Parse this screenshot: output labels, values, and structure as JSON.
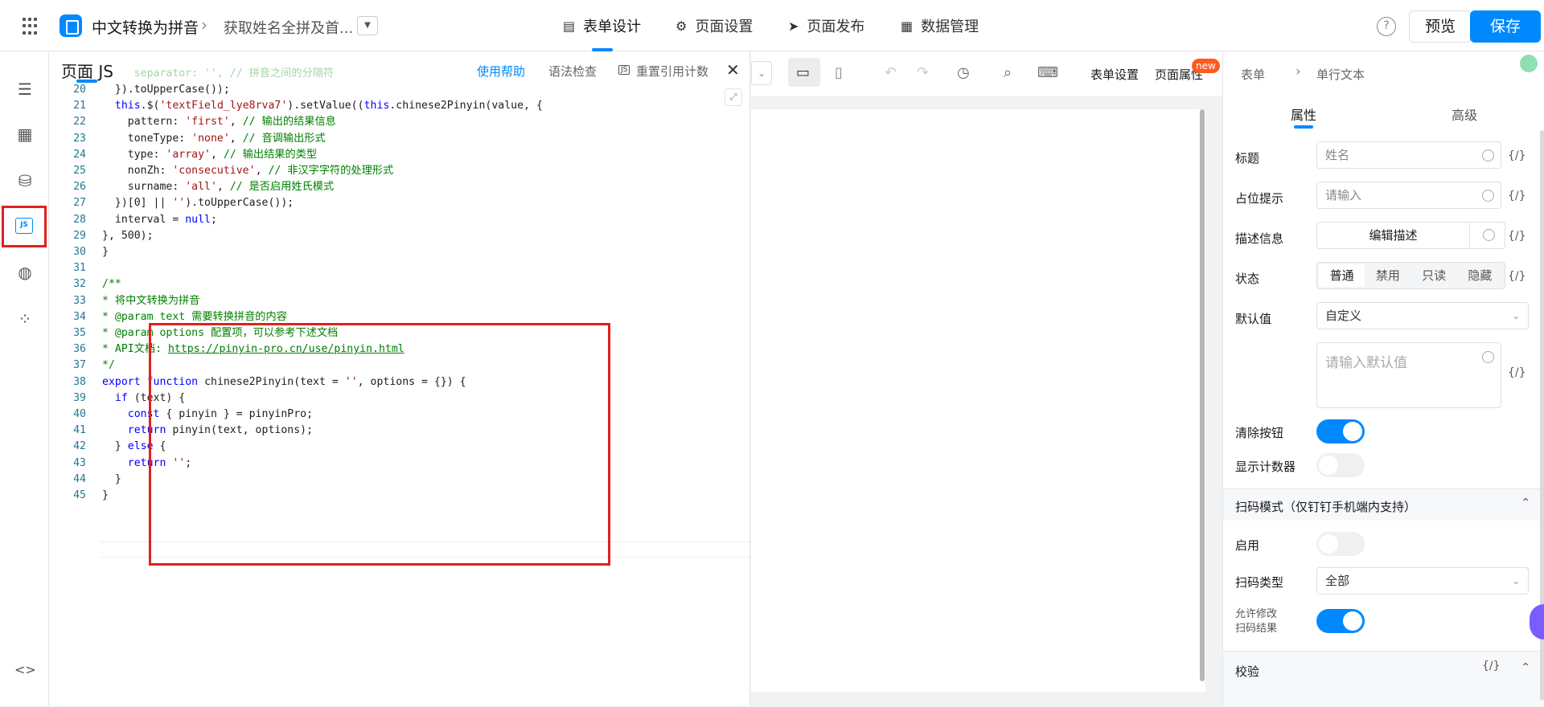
{
  "header": {
    "app_name": "中文转换为拼音",
    "page_name": "获取姓名全拼及首...",
    "nav": [
      {
        "label": "表单设计",
        "icon": "form-icon"
      },
      {
        "label": "页面设置",
        "icon": "gear-icon"
      },
      {
        "label": "页面发布",
        "icon": "send-icon"
      },
      {
        "label": "数据管理",
        "icon": "table-icon"
      }
    ],
    "help": "?",
    "preview": "预览",
    "save": "保存"
  },
  "left_rail": {
    "items": [
      "outline-icon",
      "components-icon",
      "datasource-icon",
      "js-icon",
      "globe-icon",
      "apps-icon"
    ],
    "js_label": "JS",
    "code_toggle": "<>"
  },
  "js_panel": {
    "title": "页面 JS",
    "actions": {
      "help": "使用帮助",
      "lint": "语法检查",
      "reset_icon": "JS",
      "reset": "重置引用计数",
      "close": "✕"
    },
    "expand": "⤢"
  },
  "code_lines": [
    {
      "n": "20",
      "t": "  }).toUpperCase());"
    },
    {
      "n": "21",
      "t": "  this.$('textField_lye8rva7').setValue((this.chinese2Pinyin(value, {"
    },
    {
      "n": "22",
      "t": "    pattern: 'first', // 输出的结果信息"
    },
    {
      "n": "23",
      "t": "    toneType: 'none', // 音调输出形式"
    },
    {
      "n": "24",
      "t": "    type: 'array', // 输出结果的类型"
    },
    {
      "n": "25",
      "t": "    nonZh: 'consecutive', // 非汉字字符的处理形式"
    },
    {
      "n": "26",
      "t": "    surname: 'all', // 是否启用姓氏模式"
    },
    {
      "n": "27",
      "t": "  })[0] || '').toUpperCase());"
    },
    {
      "n": "28",
      "t": "  interval = null;"
    },
    {
      "n": "29",
      "t": "}, 500);"
    },
    {
      "n": "30",
      "t": "}"
    },
    {
      "n": "31",
      "t": ""
    },
    {
      "n": "32",
      "t": "/**"
    },
    {
      "n": "33",
      "t": "* 将中文转换为拼音"
    },
    {
      "n": "34",
      "t": "* @param text 需要转换拼音的内容"
    },
    {
      "n": "35",
      "t": "* @param options 配置项，可以参考下述文档"
    },
    {
      "n": "36",
      "t": "* API文档: https://pinyin-pro.cn/use/pinyin.html"
    },
    {
      "n": "37",
      "t": "*/"
    },
    {
      "n": "38",
      "t": "export function chinese2Pinyin(text = '', options = {}) {"
    },
    {
      "n": "39",
      "t": "  if (text) {"
    },
    {
      "n": "40",
      "t": "    const { pinyin } = pinyinPro;"
    },
    {
      "n": "41",
      "t": "    return pinyin(text, options);"
    },
    {
      "n": "42",
      "t": "  } else {"
    },
    {
      "n": "43",
      "t": "    return '';"
    },
    {
      "n": "44",
      "t": "  }"
    },
    {
      "n": "45",
      "t": "}"
    }
  ],
  "canvas_toolbar": {
    "form_settings": "表单设置",
    "page_props": "页面属性",
    "new_badge": "new"
  },
  "right_panel": {
    "crumb_root": "表单",
    "crumb_leaf": "单行文本",
    "tabs": [
      "属性",
      "高级"
    ],
    "fields": {
      "title_label": "标题",
      "title_value": "姓名",
      "placeholder_label": "占位提示",
      "placeholder_value": "请输入",
      "desc_label": "描述信息",
      "desc_button": "编辑描述",
      "state_label": "状态",
      "state_options": [
        "普通",
        "禁用",
        "只读",
        "隐藏"
      ],
      "state_selected": "普通",
      "default_label": "默认值",
      "default_mode": "自定义",
      "default_placeholder": "请输入默认值",
      "clear_label": "清除按钮",
      "clear_on": true,
      "counter_label": "显示计数器",
      "counter_on": false
    },
    "scan_section": {
      "title": "扫码模式（仅钉钉手机端内支持）",
      "enable_label": "启用",
      "enable_on": false,
      "type_label": "扫码类型",
      "type_value": "全部",
      "allow_edit_label_1": "允许修改",
      "allow_edit_label_2": "扫码结果",
      "allow_edit_on": true
    },
    "validate_section": {
      "title": "校验"
    },
    "fx": "{/}"
  }
}
